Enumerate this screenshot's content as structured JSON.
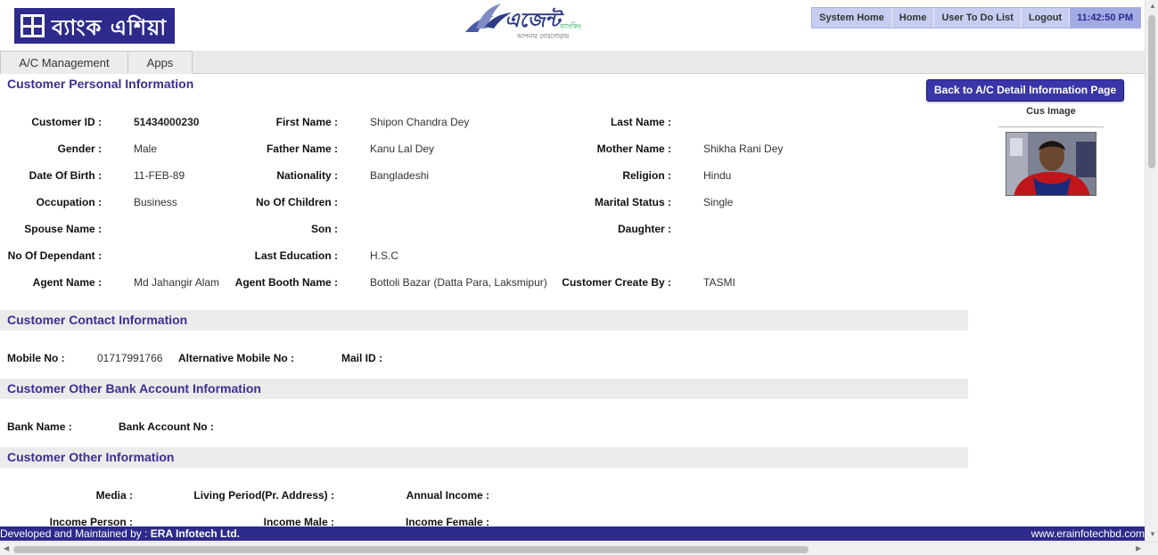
{
  "header": {
    "bank_logo_text": "ব্যাংক এশিয়া",
    "agent_logo": {
      "main": "এজেন্ট",
      "sub": "ব্যাংকিং",
      "tagline": "আপনার দোরগোড়ায়"
    },
    "top_nav": {
      "items": [
        "System Home",
        "Home",
        "User To Do List",
        "Logout"
      ],
      "clock": "11:42:50 PM"
    }
  },
  "menu": {
    "tabs": [
      "A/C Management",
      "Apps"
    ]
  },
  "personal": {
    "title": "Customer Personal Information",
    "back_button": "Back to A/C Detail Information Page",
    "image_label": "Cus Image",
    "fields": {
      "customer_id": {
        "label": "Customer ID :",
        "value": "51434000230"
      },
      "first_name": {
        "label": "First Name :",
        "value": "Shipon Chandra Dey"
      },
      "last_name": {
        "label": "Last Name :",
        "value": ""
      },
      "gender": {
        "label": "Gender :",
        "value": "Male"
      },
      "father_name": {
        "label": "Father Name :",
        "value": "Kanu Lal Dey"
      },
      "mother_name": {
        "label": "Mother Name :",
        "value": "Shikha Rani Dey"
      },
      "dob": {
        "label": "Date Of Birth :",
        "value": "11-FEB-89"
      },
      "nationality": {
        "label": "Nationality :",
        "value": "Bangladeshi"
      },
      "religion": {
        "label": "Religion :",
        "value": "Hindu"
      },
      "occupation": {
        "label": "Occupation :",
        "value": "Business"
      },
      "no_of_children": {
        "label": "No Of Children :",
        "value": ""
      },
      "marital_status": {
        "label": "Marital Status :",
        "value": "Single"
      },
      "spouse_name": {
        "label": "Spouse Name :",
        "value": ""
      },
      "son": {
        "label": "Son :",
        "value": ""
      },
      "daughter": {
        "label": "Daughter :",
        "value": ""
      },
      "no_of_dependant": {
        "label": "No Of Dependant :",
        "value": ""
      },
      "last_education": {
        "label": "Last Education :",
        "value": "H.S.C"
      },
      "agent_name": {
        "label": "Agent Name :",
        "value": "Md Jahangir Alam"
      },
      "agent_booth_name": {
        "label": "Agent Booth Name :",
        "value": "Bottoli Bazar (Datta Para, Laksmipur)"
      },
      "customer_create_by": {
        "label": "Customer Create By :",
        "value": "TASMI"
      }
    }
  },
  "contact": {
    "title": "Customer Contact Information",
    "mobile": {
      "label": "Mobile No :",
      "value": "01717991766"
    },
    "alt_mobile": {
      "label": "Alternative Mobile No :",
      "value": ""
    },
    "mail": {
      "label": "Mail ID :",
      "value": ""
    }
  },
  "other_bank": {
    "title": "Customer Other Bank Account Information",
    "bank_name": {
      "label": "Bank Name :",
      "value": ""
    },
    "bank_account_no": {
      "label": "Bank Account No :",
      "value": ""
    }
  },
  "other_info": {
    "title": "Customer Other Information",
    "media": {
      "label": "Media :",
      "value": ""
    },
    "living_period": {
      "label": "Living Period(Pr. Address) :",
      "value": ""
    },
    "annual_income": {
      "label": "Annual Income :",
      "value": ""
    },
    "income_person": {
      "label": "Income Person :",
      "value": ""
    },
    "income_male": {
      "label": "Income Male :",
      "value": ""
    },
    "income_female": {
      "label": "Income Female :",
      "value": ""
    }
  },
  "footer": {
    "prefix": "Developed and Maintained by : ",
    "company": "ERA Infotech Ltd.",
    "website": "www.erainfotechbd.com"
  },
  "colors": {
    "brand": "#2d2a8c",
    "section_title": "#3b2f94",
    "nav_bg": "#c6cdf0"
  }
}
